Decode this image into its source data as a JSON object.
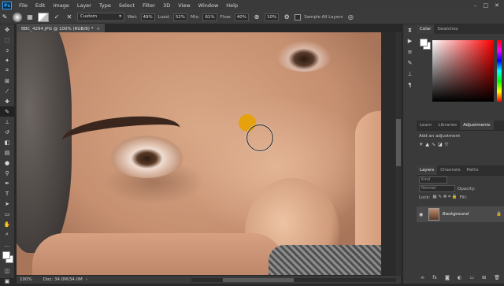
{
  "menu": {
    "logo": "Ps",
    "items": [
      "File",
      "Edit",
      "Image",
      "Layer",
      "Type",
      "Select",
      "Filter",
      "3D",
      "View",
      "Window",
      "Help"
    ],
    "window_controls": [
      "–",
      "□",
      "✕"
    ]
  },
  "options": {
    "mode": "Custom",
    "wet_label": "Wet:",
    "wet_value": "49%",
    "load_label": "Load:",
    "load_value": "52%",
    "mix_label": "Mix:",
    "mix_value": "61%",
    "flow_label": "Flow:",
    "flow_value": "40%",
    "smoothing_value": "10%",
    "sample_all_label": "Sample All Layers"
  },
  "document": {
    "tab_title": "BBC_4294.JPG @ 100% (RGB/8) *"
  },
  "status": {
    "zoom": "100%",
    "doc": "Doc: 34.0M/34.0M"
  },
  "panels": {
    "color_tabs": [
      "Color",
      "Swatches"
    ],
    "adjust_tabs": [
      "Learn",
      "Libraries",
      "Adjustments"
    ],
    "add_adjustment": "Add an adjustment",
    "layers_tabs": [
      "Layers",
      "Channels",
      "Paths"
    ],
    "kind_label": "Kind",
    "blend_mode": "Normal",
    "opacity_label": "Opacity:",
    "lock_label": "Lock:",
    "fill_label": "Fill:",
    "layer_name": "Background"
  }
}
